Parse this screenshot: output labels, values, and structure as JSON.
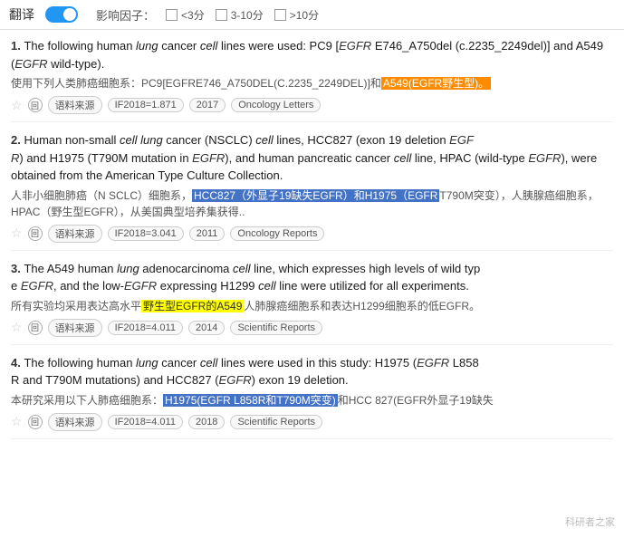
{
  "topbar": {
    "translate_label": "翻译",
    "influence_label": "影响因子：",
    "filter1": "<3分",
    "filter2": "3-10分",
    "filter3": ">10分"
  },
  "results": [
    {
      "number": "1.",
      "english": "The following human lung cancer cell lines were used: PC9 [EGFR E746_A750del (c.2235_2249del)] and A549 (EGFR wild-type).",
      "chinese": "使用下列人类肺癌细胞系：PC9[EGFRE746_A750DEL(C.2235_2249DEL)]和A549(EGFR野生型)。",
      "if_label": "语料来源",
      "if_value": "IF2018=1.871",
      "year": "2017",
      "journal": "Oncology Letters"
    },
    {
      "number": "2.",
      "english": "Human non-small cell lung cancer (NSCLC) cell lines, HCC827 (exon 19 deletion EGFR) and H1975 (T790M mutation in EGFR), and human pancreatic cancer cell line, HPAC (wild-type EGFR), were obtained from the American Type Culture Collection.",
      "chinese": "人非小细胞肺癌（N SCLC）细胞系，HCC827（外显子19缺失EGFR）和H1975（EGFR T790M突变），人胰腺癌细胞系，HPAC（野生型EGFR），从美国典型培养集获得..",
      "if_label": "语料来源",
      "if_value": "IF2018=3.041",
      "year": "2011",
      "journal": "Oncology Reports"
    },
    {
      "number": "3.",
      "english": "The A549 human lung adenocarcinoma cell line, which expresses high levels of wild type EGFR, and the low-EGFR expressing H1299 cell line were utilized for all experiments.",
      "chinese": "所有实验均采用表达高水平野生型EGFR的A549人肺腺癌细胞系和表达H1299细胞系的低EGFR。",
      "if_label": "语料来源",
      "if_value": "IF2018=4.011",
      "year": "2014",
      "journal": "Scientific Reports"
    },
    {
      "number": "4.",
      "english": "The following human lung cancer cell lines were used in this study: H1975 (EGFR L858R and T790M mutations) and HCC827 (EGFR exon 19 deletion.",
      "chinese": "本研究采用以下人肺癌细胞系：H1975(EGFR L858R和T790M突变)和HCC 827(EGFR外显子19缺失",
      "if_label": "语料来源",
      "if_value": "IF2018=4.011",
      "year": "2018",
      "journal": "Scientific Reports"
    }
  ],
  "watermark": "科研者之家"
}
